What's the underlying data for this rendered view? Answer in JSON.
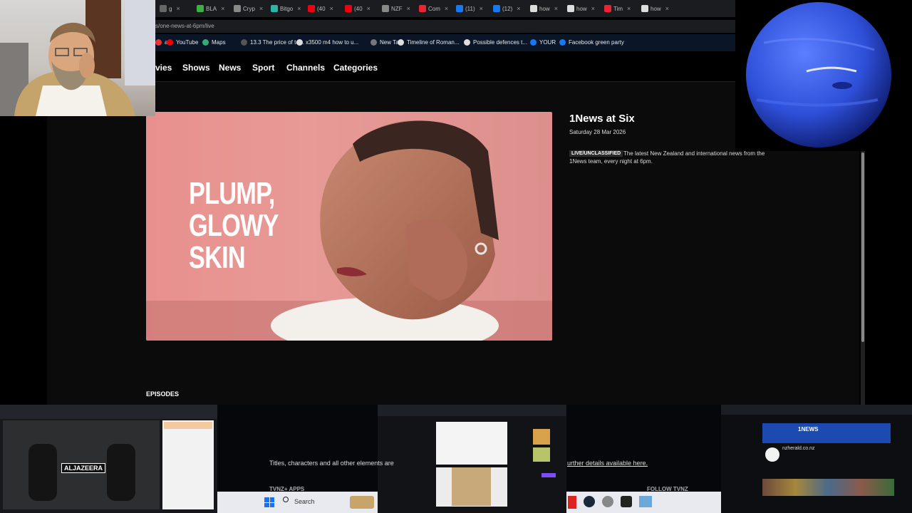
{
  "tabs": [
    {
      "label": "g",
      "color": "#666"
    },
    {
      "label": "BLA",
      "color": "#3cb043"
    },
    {
      "label": "Cryp",
      "color": "#888"
    },
    {
      "label": "Bitgo",
      "color": "#2bb5a6"
    },
    {
      "label": "(40",
      "color": "#e01"
    },
    {
      "label": "(40",
      "color": "#e01"
    },
    {
      "label": "NZF",
      "color": "#888"
    },
    {
      "label": "Com",
      "color": "#e23"
    },
    {
      "label": "(11)",
      "color": "#1877f2"
    },
    {
      "label": "(12)",
      "color": "#1877f2"
    },
    {
      "label": "how",
      "color": "#ddd"
    },
    {
      "label": "how",
      "color": "#ddd"
    },
    {
      "label": "Tim",
      "color": "#e23"
    },
    {
      "label": "how",
      "color": "#ddd"
    }
  ],
  "url": "s/one-news-at-6pm/live",
  "bookmarks": [
    {
      "label": "ail",
      "color": "#e33"
    },
    {
      "label": "YouTube",
      "color": "#e00"
    },
    {
      "label": "Maps",
      "color": "#3a7"
    },
    {
      "label": "13.3 The price of to...",
      "color": "#555"
    },
    {
      "label": "x3500 m4 how to u...",
      "color": "#ddd"
    },
    {
      "label": "New Tab",
      "color": "#777"
    },
    {
      "label": "Timeline of Roman...",
      "color": "#ddd"
    },
    {
      "label": "Possible defences t...",
      "color": "#ddd"
    },
    {
      "label": "YOUR",
      "color": "#1877f2"
    },
    {
      "label": "Facebook green party",
      "color": "#1877f2"
    }
  ],
  "nav": [
    "vies",
    "Shows",
    "News",
    "Sport",
    "Channels",
    "Categories"
  ],
  "video": {
    "promo": [
      "PLUMP,",
      "GLOWY",
      "SKIN"
    ]
  },
  "show": {
    "title": "1News at Six",
    "date": "Saturday 28 Mar 2026",
    "badge": "LIVE/UNCLASSIFIED",
    "description": "The latest New Zealand and international news from the 1News team, every night at 6pm."
  },
  "episodes_label": "EPISODES",
  "footer": {
    "legal": "Titles, characters and all other elements are",
    "legal_link": "urther details available here.",
    "apps": "TVNZ+ APPS",
    "follow": "FOLLOW TVNZ"
  },
  "thumbs": {
    "aljazeera": "ALJAZEERA",
    "search": "Search",
    "nzherald": "nzherald.co.nz",
    "onenews": "1NEWS"
  }
}
